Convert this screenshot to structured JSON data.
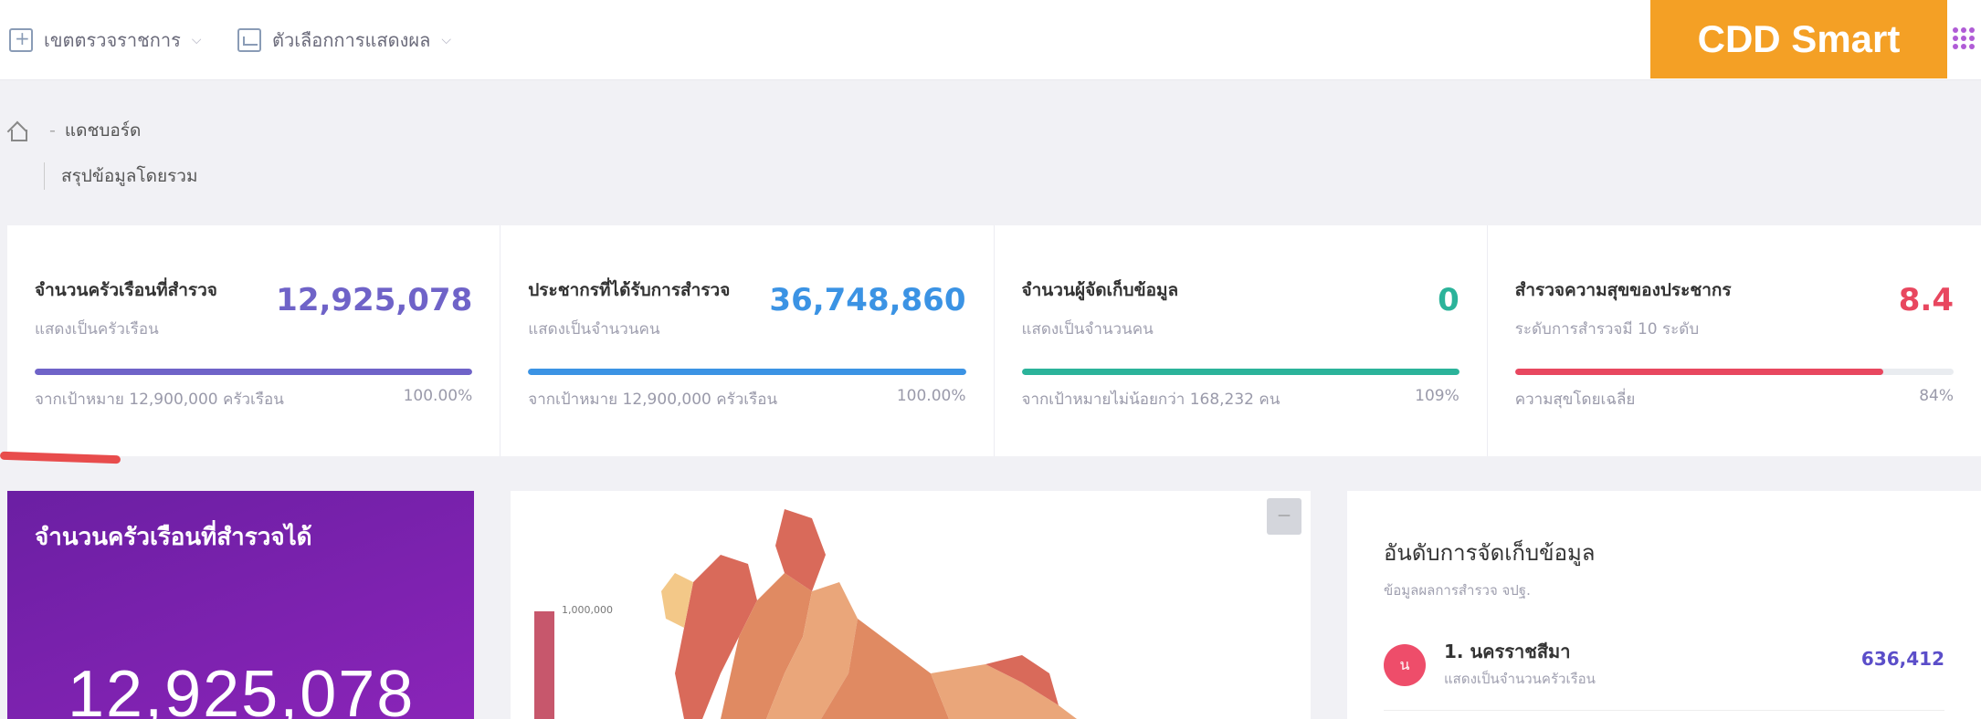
{
  "topbar": {
    "menu1": "เขตตรวจราชการ",
    "menu2": "ตัวเลือกการแสดงผล",
    "brand": "CDD Smart"
  },
  "breadcrumb": {
    "page": "แดชบอร์ด",
    "subtitle": "สรุปข้อมูลโดยรวม"
  },
  "stats": [
    {
      "title": "จำนวนครัวเรือนที่สำรวจ",
      "sub": "แสดงเป็นครัวเรือน",
      "value": "12,925,078",
      "foot_left": "จากเป้าหมาย 12,900,000 ครัวเรือน",
      "foot_right": "100.00%",
      "progress": 1.0,
      "color": "#6f63c8"
    },
    {
      "title": "ประชากรที่ได้รับการสำรวจ",
      "sub": "แสดงเป็นจำนวนคน",
      "value": "36,748,860",
      "foot_left": "จากเป้าหมาย 12,900,000 ครัวเรือน",
      "foot_right": "100.00%",
      "progress": 1.0,
      "color": "#3b93e4"
    },
    {
      "title": "จำนวนผู้จัดเก็บข้อมูล",
      "sub": "แสดงเป็นจำนวนคน",
      "value": "0",
      "foot_left": "จากเป้าหมายไม่น้อยกว่า 168,232 คน",
      "foot_right": "109%",
      "progress": 1.0,
      "color": "#2bb39a"
    },
    {
      "title": "สำรวจความสุขของประชากร",
      "sub": "ระดับการสำรวจมี 10 ระดับ",
      "value": "8.4",
      "foot_left": "ความสุขโดยเฉลี่ย",
      "foot_right": "84%",
      "progress": 0.84,
      "color": "#e8475f"
    }
  ],
  "households_card": {
    "title": "จำนวนครัวเรือนที่สำรวจได้",
    "value": "12,925,078"
  },
  "map_card": {
    "legend_max": "1,000,000",
    "button": "—"
  },
  "ranking": {
    "title": "อันดับการจัดเก็บข้อมูล",
    "subtitle": "ข้อมูลผลการสำรวจ จปฐ.",
    "items": [
      {
        "badge": "น",
        "name": "1. นครราชสีมา",
        "unit": "แสดงเป็นจำนวนครัวเรือน",
        "value": "636,412"
      }
    ]
  }
}
